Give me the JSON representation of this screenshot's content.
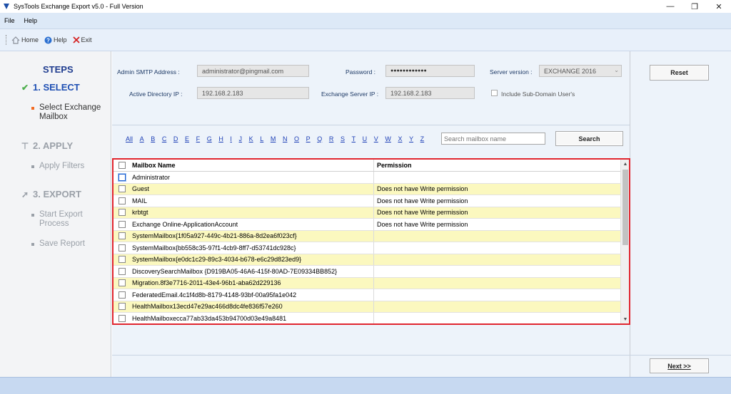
{
  "window": {
    "title": "SysTools Exchange Export v5.0 - Full Version",
    "minimize": "—",
    "restore": "❐",
    "close": "✕"
  },
  "menu": {
    "items": [
      "File",
      "Help"
    ]
  },
  "toolbar": {
    "home": "Home",
    "help": "Help",
    "exit": "Exit"
  },
  "sidebar": {
    "heading": "STEPS",
    "step1": {
      "label": "1. SELECT",
      "icon": "✔",
      "sub": [
        "Select Exchange",
        "Mailbox"
      ]
    },
    "step2": {
      "label": "2. APPLY",
      "icon": "⊤",
      "sub": [
        "Apply Filters"
      ]
    },
    "step3": {
      "label": "3. EXPORT",
      "icon": "➚",
      "sub1": [
        "Start Export",
        "Process"
      ],
      "sub2": [
        "Save Report"
      ]
    }
  },
  "form": {
    "admin_smtp_label": "Admin SMTP Address :",
    "admin_smtp_value": "administrator@pingmail.com",
    "password_label": "Password :",
    "password_value": "●●●●●●●●●●●●",
    "server_version_label": "Server version :",
    "server_version_value": "EXCHANGE 2016",
    "ad_ip_label": "Active Directory IP :",
    "ad_ip_value": "192.168.2.183",
    "exchange_ip_label": "Exchange Server IP :",
    "exchange_ip_value": "192.168.2.183",
    "subdomain_label": "Include Sub-Domain User's"
  },
  "buttons": {
    "reset": "Reset",
    "search": "Search",
    "next": "Next >>"
  },
  "alphabet": [
    "All",
    "A",
    "B",
    "C",
    "D",
    "E",
    "F",
    "G",
    "H",
    "I",
    "J",
    "K",
    "L",
    "M",
    "N",
    "O",
    "P",
    "Q",
    "R",
    "S",
    "T",
    "U",
    "V",
    "W",
    "X",
    "Y",
    "Z"
  ],
  "search": {
    "placeholder": "Search mailbox name"
  },
  "table": {
    "headers": {
      "name": "Mailbox Name",
      "permission": "Permission"
    },
    "rows": [
      {
        "name": "Administrator",
        "permission": ""
      },
      {
        "name": "Guest",
        "permission": "Does not have Write permission"
      },
      {
        "name": "MAIL",
        "permission": "Does not have Write permission"
      },
      {
        "name": "krbtgt",
        "permission": "Does not have Write permission"
      },
      {
        "name": "Exchange Online-ApplicationAccount",
        "permission": "Does not have Write permission"
      },
      {
        "name": "SystemMailbox{1f05a927-449c-4b21-886a-8d2ea6f023cf}",
        "permission": ""
      },
      {
        "name": "SystemMailbox{bb558c35-97f1-4cb9-8ff7-d53741dc928c}",
        "permission": ""
      },
      {
        "name": "SystemMailbox{e0dc1c29-89c3-4034-b678-e6c29d823ed9}",
        "permission": ""
      },
      {
        "name": "DiscoverySearchMailbox {D919BA05-46A6-415f-80AD-7E09334BB852}",
        "permission": ""
      },
      {
        "name": "Migration.8f3e7716-2011-43e4-96b1-aba62d229136",
        "permission": ""
      },
      {
        "name": "FederatedEmail.4c1f4d8b-8179-4148-93bf-00a95fa1e042",
        "permission": ""
      },
      {
        "name": "HealthMailbox13ecd47e29ac466d8dc4fe836f57e260",
        "permission": ""
      },
      {
        "name": "HealthMailboxecca77ab33da453b94700d03e49a8481",
        "permission": ""
      }
    ]
  },
  "colors": {
    "accent": "#1e4fb3",
    "highlight_row": "#fbf8bf",
    "grid_border": "#e0252f",
    "active_bullet": "#f26b22"
  }
}
